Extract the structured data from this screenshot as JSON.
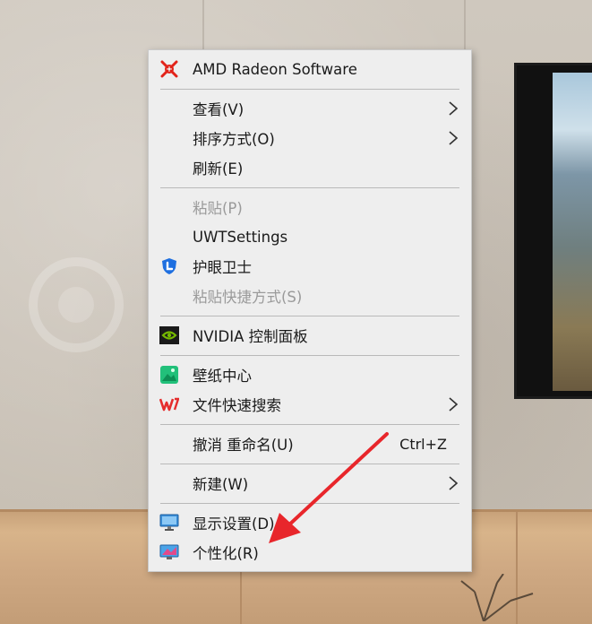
{
  "menu": {
    "items": [
      {
        "label": "AMD Radeon Software",
        "icon": "amd-radeon-icon"
      },
      {
        "label": "查看(V)",
        "submenu": true
      },
      {
        "label": "排序方式(O)",
        "submenu": true
      },
      {
        "label": "刷新(E)"
      },
      {
        "label": "粘贴(P)",
        "disabled": true
      },
      {
        "label": "UWTSettings"
      },
      {
        "label": "护眼卫士",
        "icon": "eye-guard-shield-icon"
      },
      {
        "label": "粘贴快捷方式(S)",
        "disabled": true
      },
      {
        "label": "NVIDIA 控制面板",
        "icon": "nvidia-icon"
      },
      {
        "label": "壁纸中心",
        "icon": "wallpaper-center-icon"
      },
      {
        "label": "文件快速搜索",
        "icon": "wps-icon",
        "submenu": true
      },
      {
        "label": "撤消 重命名(U)",
        "shortcut": "Ctrl+Z"
      },
      {
        "label": "新建(W)",
        "submenu": true
      },
      {
        "label": "显示设置(D)",
        "icon": "display-settings-icon"
      },
      {
        "label": "个性化(R)",
        "icon": "personalization-icon"
      }
    ]
  },
  "colors": {
    "menu_bg": "#eeeeee",
    "separator": "#b9b9b9",
    "disabled_text": "#9a9a9a",
    "arrow_annotation": "#e8262b",
    "amd_red": "#e2231a",
    "nvidia_green": "#76b900"
  }
}
